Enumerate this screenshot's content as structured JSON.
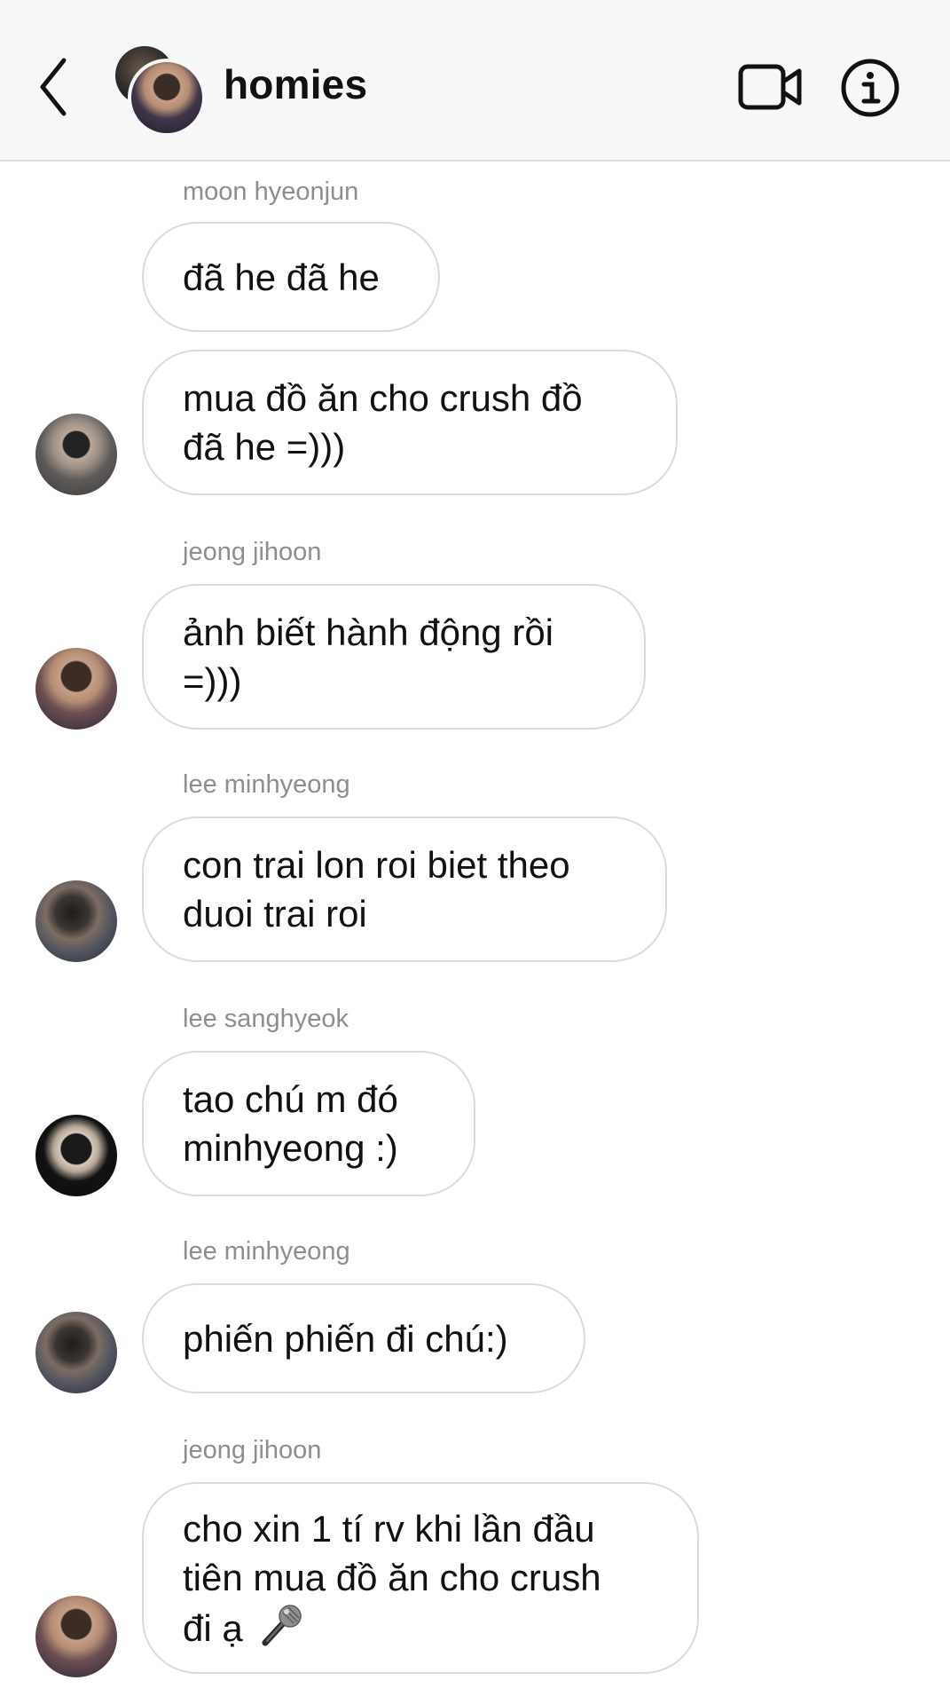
{
  "header": {
    "title": "homies",
    "back_icon": "chevron-left-icon",
    "video_icon": "video-camera-icon",
    "info_icon": "info-icon"
  },
  "messages": [
    {
      "sender": "moon hyeonjun",
      "bubbles": [
        {
          "lines": [
            "đã he đã he"
          ]
        },
        {
          "lines": [
            "mua đồ ăn cho crush đồ",
            "đã he =)))"
          ]
        }
      ]
    },
    {
      "sender": "jeong jihoon",
      "bubbles": [
        {
          "lines": [
            "ảnh biết hành động rồi",
            "=)))"
          ]
        }
      ]
    },
    {
      "sender": "lee minhyeong",
      "bubbles": [
        {
          "lines": [
            "con trai lon roi biet theo",
            "duoi trai roi"
          ]
        }
      ]
    },
    {
      "sender": "lee sanghyeok",
      "bubbles": [
        {
          "lines": [
            "tao chú m đó",
            "minhyeong :)"
          ]
        }
      ]
    },
    {
      "sender": "lee minhyeong",
      "bubbles": [
        {
          "lines": [
            "phiến phiến đi chú:)"
          ]
        }
      ]
    },
    {
      "sender": "jeong jihoon",
      "bubbles": [
        {
          "lines": [
            "cho xin 1 tí rv khi lần đầu",
            "tiên mua đồ ăn cho crush",
            "đi ạ"
          ],
          "emoji": "microphone-icon"
        }
      ]
    }
  ]
}
